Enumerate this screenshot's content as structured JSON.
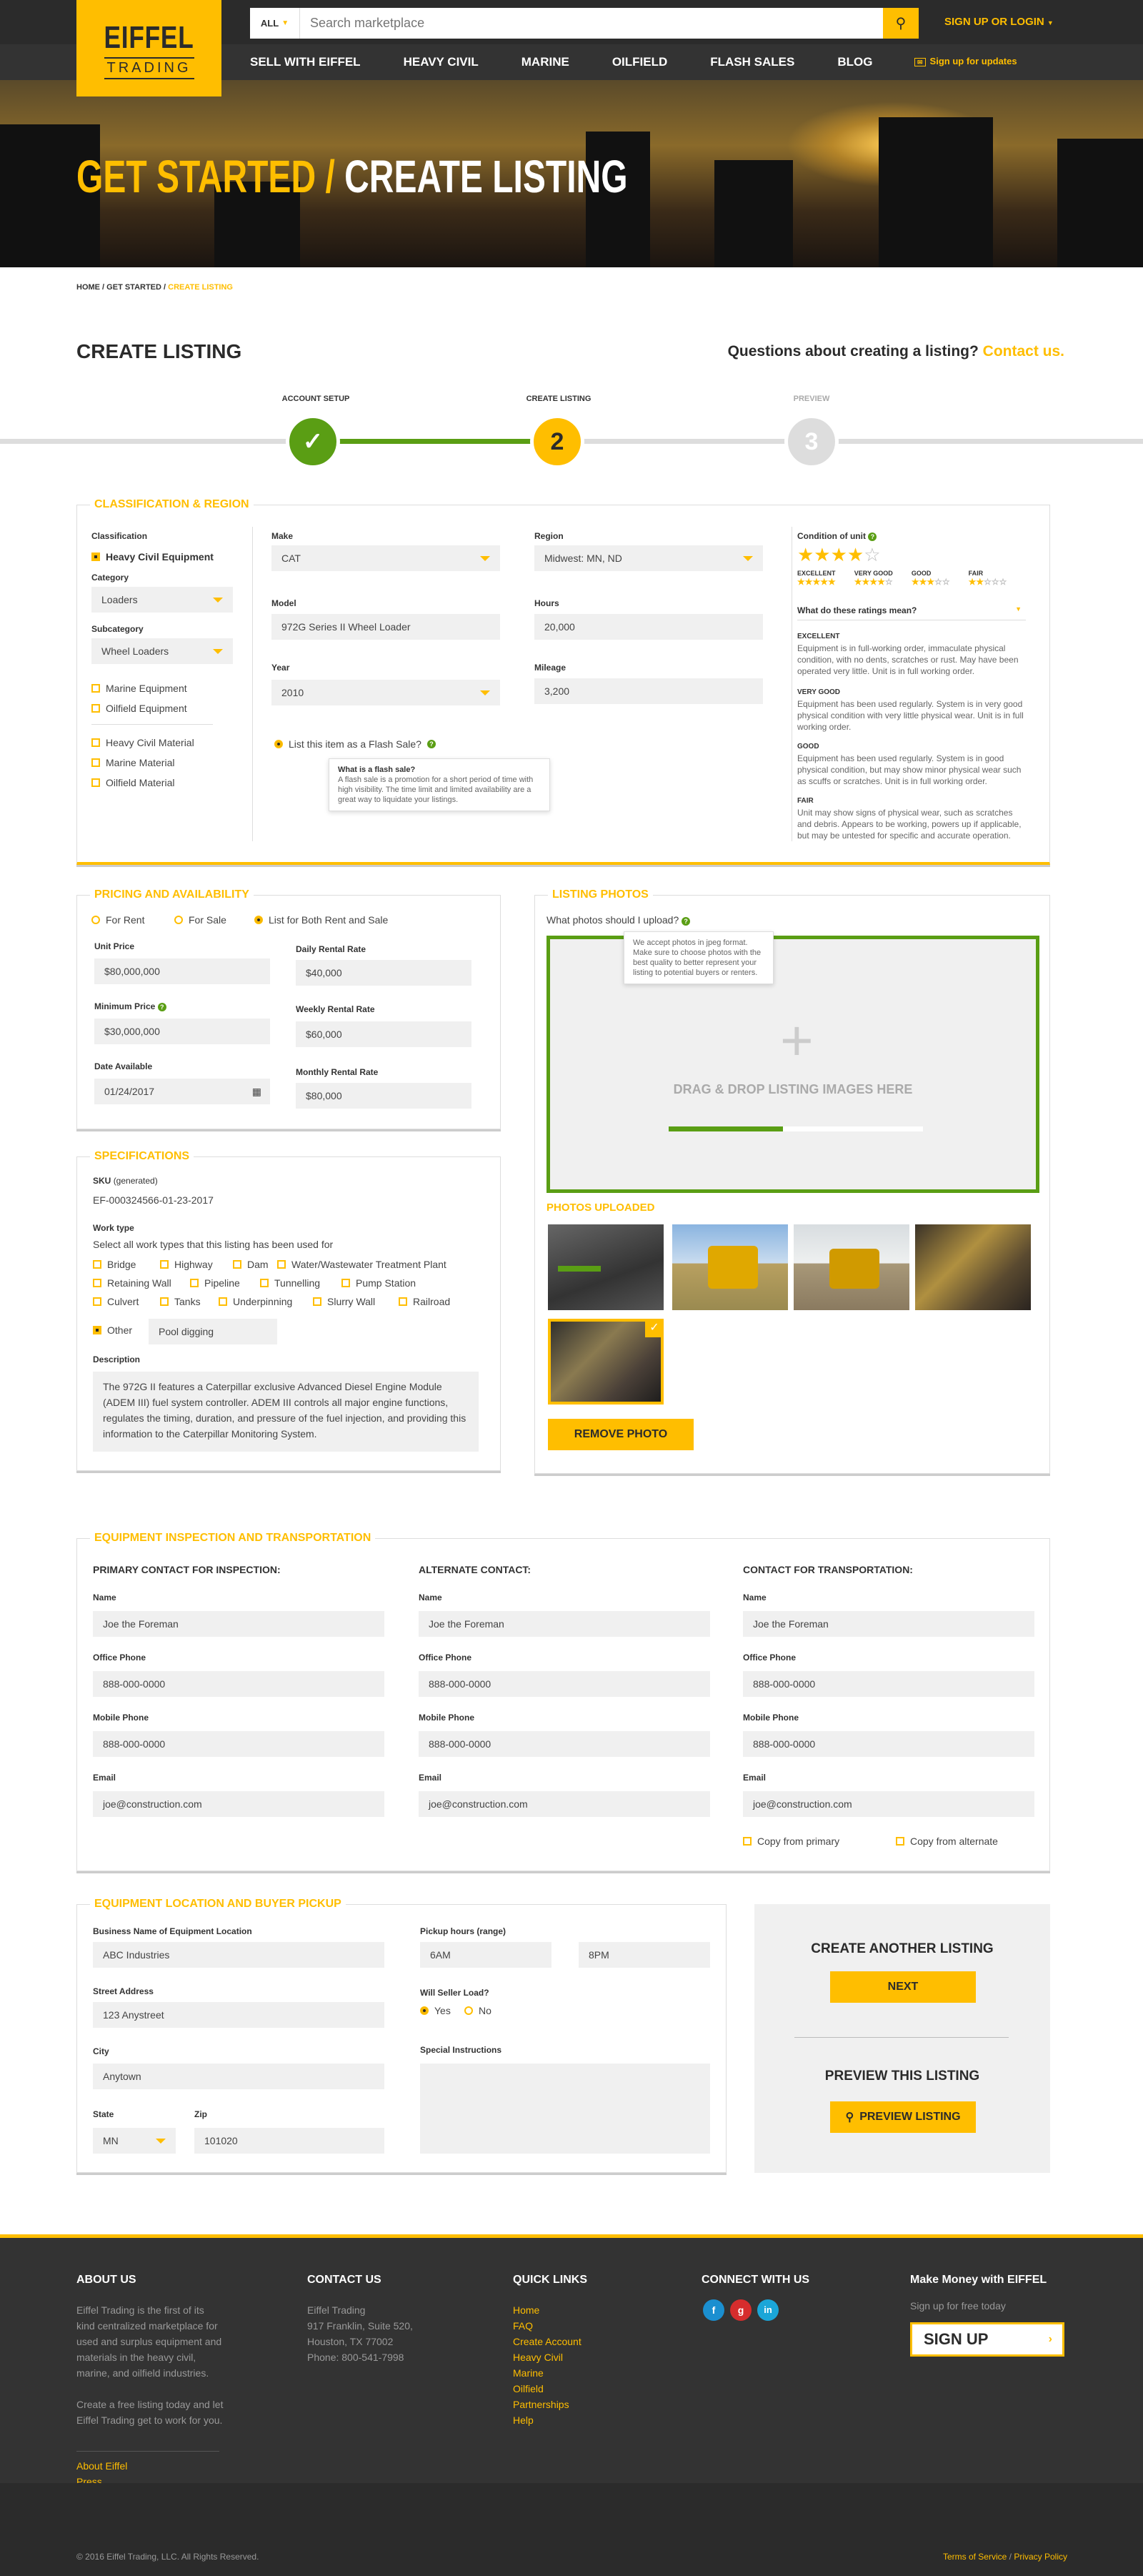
{
  "header": {
    "logo_top": "EIFFEL",
    "logo_bottom": "TRADING",
    "search_scope": "ALL",
    "search_placeholder": "Search marketplace",
    "login": "SIGN UP OR LOGIN",
    "updates": "Sign up for updates",
    "nav": [
      "SELL WITH EIFFEL",
      "HEAVY CIVIL",
      "MARINE",
      "OILFIELD",
      "FLASH SALES",
      "BLOG"
    ]
  },
  "hero": {
    "part1": "GET STARTED",
    "sep": "/",
    "part2": "CREATE LISTING"
  },
  "breadcrumb": {
    "home": "HOME",
    "sep1": " / ",
    "started": "GET STARTED",
    "sep2": " / ",
    "current": "CREATE LISTING"
  },
  "page": {
    "title": "CREATE LISTING",
    "question": "Questions about creating a listing?",
    "contact": "Contact us."
  },
  "steps": [
    {
      "label": "ACCOUNT SETUP",
      "num": "✓"
    },
    {
      "label": "CREATE LISTING",
      "num": "2"
    },
    {
      "label": "PREVIEW",
      "num": "3"
    }
  ],
  "classification": {
    "title": "CLASSIFICATION & REGION",
    "class_label": "Classification",
    "class_value": "Heavy Civil Equipment",
    "category_label": "Category",
    "category": "Loaders",
    "subcategory_label": "Subcategory",
    "subcategory": "Wheel Loaders",
    "others": [
      "Marine Equipment",
      "Oilfield Equipment",
      "Heavy Civil Material",
      "Marine Material",
      "Oilfield Material"
    ],
    "make_label": "Make",
    "make": "CAT",
    "model_label": "Model",
    "model": "972G Series II Wheel Loader",
    "year_label": "Year",
    "year": "2010",
    "region_label": "Region",
    "region": "Midwest: MN, ND",
    "hours_label": "Hours",
    "hours": "20,000",
    "mileage_label": "Mileage",
    "mileage": "3,200",
    "flash_label": "List this item as a Flash Sale?",
    "flash_tip_title": "What is a flash sale?",
    "flash_tip": "A flash sale is a promotion for a short period of time with high visibility. The time limit and limited availability are a great way to liquidate your listings.",
    "condition_label": "Condition of unit",
    "ratings": [
      "EXCELLENT",
      "VERY GOOD",
      "GOOD",
      "FAIR"
    ],
    "ratings_q": "What do these ratings mean?",
    "rating_desc": [
      {
        "t": "EXCELLENT",
        "d": "Equipment is in full-working order, immaculate physical condition, with no dents, scratches or rust. May have been operated very little. Unit is in full working order."
      },
      {
        "t": "VERY GOOD",
        "d": "Equipment has been used regularly. System is in very good physical condition with very little physical wear. Unit is in full working order."
      },
      {
        "t": "GOOD",
        "d": "Equipment has been used regularly. System is in good physical condition, but may show minor physical wear such as scuffs or scratches. Unit is in full working order."
      },
      {
        "t": "FAIR",
        "d": "Unit may show signs of physical wear, such as scratches and debris. Appears to be working, powers up if applicable, but may be untested for specific and accurate operation."
      }
    ]
  },
  "pricing": {
    "title": "PRICING AND AVAILABILITY",
    "opts": [
      "For Rent",
      "For Sale",
      "List for Both Rent and Sale"
    ],
    "unit_label": "Unit Price",
    "unit": "$80,000,000",
    "min_label": "Minimum Price",
    "min": "$30,000,000",
    "date_label": "Date Available",
    "date": "01/24/2017",
    "daily_label": "Daily Rental Rate",
    "daily": "$40,000",
    "weekly_label": "Weekly Rental Rate",
    "weekly": "$60,000",
    "monthly_label": "Monthly Rental Rate",
    "monthly": "$80,000"
  },
  "specs": {
    "title": "SPECIFICATIONS",
    "sku_label": "SKU",
    "sku_note": "(generated)",
    "sku": "EF-000324566-01-23-2017",
    "work_label": "Work type",
    "work_hint": "Select all work types that this listing has been used for",
    "work": [
      "Bridge",
      "Highway",
      "Dam",
      "Water/Wastewater Treatment Plant",
      "Retaining Wall",
      "Pipeline",
      "Tunnelling",
      "Pump Station",
      "Culvert",
      "Tanks",
      "Underpinning",
      "Slurry Wall",
      "Railroad"
    ],
    "other_label": "Other",
    "other": "Pool digging",
    "desc_label": "Description",
    "desc": "The 972G II features a Caterpillar exclusive Advanced Diesel Engine Module (ADEM III) fuel system controller. ADEM III controls all major engine functions, regulates the timing, duration, and pressure of the fuel injection, and providing this information to the Caterpillar Monitoring System."
  },
  "photos": {
    "title": "LISTING PHOTOS",
    "q": "What photos should I upload?",
    "tip": "We accept photos in jpeg format. Make sure to choose photos with the best quality to better represent your listing to potential buyers or renters.",
    "drop": "DRAG & DROP LISTING IMAGES HERE",
    "progress": 0.45,
    "uploaded": "PHOTOS UPLOADED",
    "remove": "REMOVE PHOTO"
  },
  "inspection": {
    "title": "EQUIPMENT INSPECTION AND TRANSPORTATION",
    "cols": [
      {
        "h": "PRIMARY CONTACT FOR INSPECTION:"
      },
      {
        "h": "ALTERNATE CONTACT:"
      },
      {
        "h": "CONTACT FOR TRANSPORTATION:"
      }
    ],
    "name_label": "Name",
    "name": "Joe the Foreman",
    "office_label": "Office Phone",
    "office": "888-000-0000",
    "mobile_label": "Mobile Phone",
    "mobile": "888-000-0000",
    "email_label": "Email",
    "email": "joe@construction.com",
    "copy1": "Copy from primary",
    "copy2": "Copy from alternate"
  },
  "location": {
    "title": "EQUIPMENT LOCATION AND BUYER PICKUP",
    "biz_label": "Business Name of Equipment Location",
    "biz": "ABC Industries",
    "street_label": "Street Address",
    "street": "123 Anystreet",
    "city_label": "City",
    "city": "Anytown",
    "state_label": "State",
    "state": "MN",
    "zip_label": "Zip",
    "zip": "101020",
    "hours_label": "Pickup hours (range)",
    "from": "6AM",
    "to": "8PM",
    "load_label": "Will Seller Load?",
    "yes": "Yes",
    "no": "No",
    "special_label": "Special Instructions"
  },
  "actions": {
    "another": "CREATE ANOTHER LISTING",
    "next": "NEXT",
    "preview_h": "PREVIEW THIS LISTING",
    "preview": "PREVIEW LISTING"
  },
  "footer": {
    "about_h": "ABOUT US",
    "about": "Eiffel Trading is the first of its kind centralized marketplace for used and surplus equipment and materials in the heavy civil, marine, and oilfield industries.",
    "about2": "Create a free listing today and let Eiffel Trading get to work for you.",
    "about_links": [
      "About Eiffel",
      "Press"
    ],
    "contact_h": "CONTACT US",
    "contact": [
      "Eiffel Trading",
      "917 Franklin, Suite 520,",
      "Houston, TX 77002",
      "Phone: 800-541-7998"
    ],
    "quick_h": "QUICK LINKS",
    "quick": [
      "Home",
      "FAQ",
      "Create Account",
      "Heavy Civil",
      "Marine",
      "Oilfield",
      "Partnerships",
      "Help"
    ],
    "connect_h": "CONNECT WITH US",
    "money_h": "Make Money with EIFFEL",
    "money": "Sign up for free today",
    "signup": "SIGN UP",
    "copyright": "© 2016 Eiffel Trading, LLC. All Rights Reserved.",
    "terms": "Terms of Service",
    "sep": " / ",
    "privacy": "Privacy Policy"
  },
  "colors": {
    "accent": "#ffbe00",
    "dark": "#2b2b2b",
    "green": "#5a9e14"
  }
}
